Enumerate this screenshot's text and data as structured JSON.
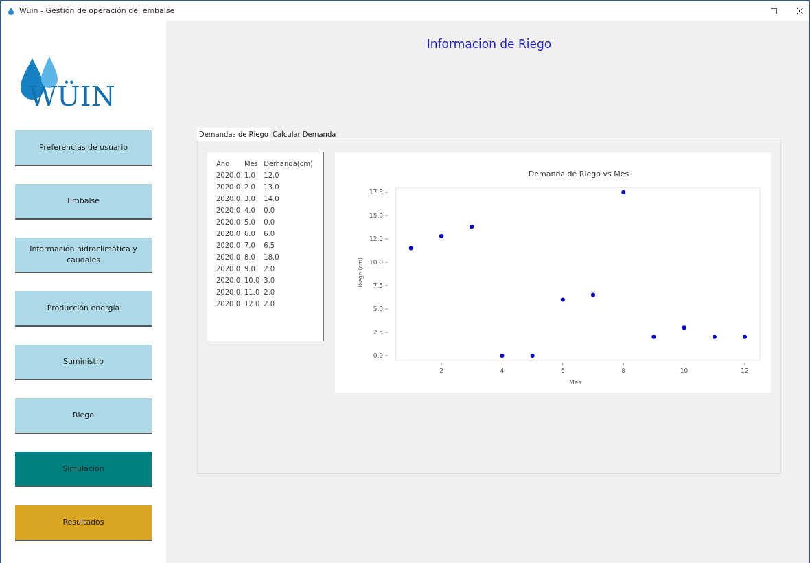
{
  "window": {
    "title": "Wüin - Gestión de operación del embalse"
  },
  "logo": {
    "text": "WÜIN"
  },
  "sidebar": {
    "items": [
      {
        "label": "Preferencias de usuario",
        "kind": "light"
      },
      {
        "label": "Embalse",
        "kind": "light"
      },
      {
        "label": "Información hidroclimática y caudales",
        "kind": "light"
      },
      {
        "label": "Producción energía",
        "kind": "light"
      },
      {
        "label": "Suministro",
        "kind": "light"
      },
      {
        "label": "Riego",
        "kind": "light"
      },
      {
        "label": "Simulación",
        "kind": "teal"
      },
      {
        "label": "Resultados",
        "kind": "gold"
      }
    ]
  },
  "heading": "Informacion de Riego",
  "tabs": [
    {
      "label": "Demandas de Riego",
      "selected": true
    },
    {
      "label": "Calcular Demanda",
      "selected": false
    }
  ],
  "table": {
    "columns": [
      "Año",
      "Mes",
      "Demanda(cm)"
    ],
    "rows": [
      [
        "2020.0",
        "1.0",
        "12.0"
      ],
      [
        "2020.0",
        "2.0",
        "13.0"
      ],
      [
        "2020.0",
        "3.0",
        "14.0"
      ],
      [
        "2020.0",
        "4.0",
        "0.0"
      ],
      [
        "2020.0",
        "5.0",
        "0.0"
      ],
      [
        "2020.0",
        "6.0",
        "6.0"
      ],
      [
        "2020.0",
        "7.0",
        "6.5"
      ],
      [
        "2020.0",
        "8.0",
        "18.0"
      ],
      [
        "2020.0",
        "9.0",
        "2.0"
      ],
      [
        "2020.0",
        "10.0",
        "3.0"
      ],
      [
        "2020.0",
        "11.0",
        "2.0"
      ],
      [
        "2020.0",
        "12.0",
        "2.0"
      ]
    ]
  },
  "chart_data": {
    "type": "scatter",
    "title": "Demanda de Riego vs Mes",
    "xlabel": "Mes",
    "ylabel": "Riego (cm)",
    "x": [
      1,
      2,
      3,
      4,
      5,
      6,
      7,
      8,
      9,
      10,
      11,
      12
    ],
    "xlim": [
      0.5,
      12.5
    ],
    "ylim": [
      -0.5,
      18
    ],
    "series": [
      {
        "color": "#0000cc",
        "values": [
          11.5,
          12.8,
          13.8,
          0,
          0,
          6,
          6.5,
          17.5,
          2,
          3,
          2,
          2
        ]
      }
    ],
    "xticks": [
      2,
      4,
      6,
      8,
      10,
      12
    ],
    "yticks": [
      {
        "value": 0,
        "label": "0.0"
      },
      {
        "value": 2.5,
        "label": "2.5"
      },
      {
        "value": 5,
        "label": "5.0"
      },
      {
        "value": 7.5,
        "label": "7.5"
      },
      {
        "value": 10,
        "label": "10.0"
      },
      {
        "value": 12.5,
        "label": "12.5"
      },
      {
        "value": 15,
        "label": "15.0"
      },
      {
        "value": 17.5,
        "label": "17.5"
      }
    ]
  }
}
